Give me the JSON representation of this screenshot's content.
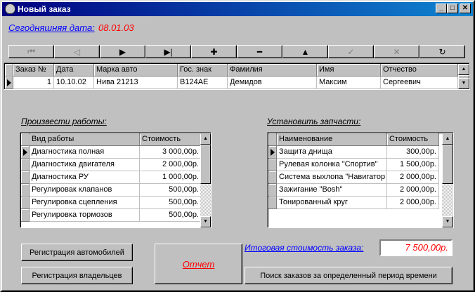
{
  "window": {
    "title": "Новый заказ"
  },
  "today": {
    "label": "Сегодняшняя дата:",
    "value": "08.01.03"
  },
  "navigator": [
    {
      "name": "first",
      "glyph": "⏮",
      "enabled": false
    },
    {
      "name": "prior",
      "glyph": "◁",
      "enabled": false
    },
    {
      "name": "next",
      "glyph": "▶",
      "enabled": true
    },
    {
      "name": "last",
      "glyph": "▶|",
      "enabled": true
    },
    {
      "name": "insert",
      "glyph": "✚",
      "enabled": true
    },
    {
      "name": "delete",
      "glyph": "━",
      "enabled": true
    },
    {
      "name": "edit",
      "glyph": "▲",
      "enabled": true
    },
    {
      "name": "post",
      "glyph": "✓",
      "enabled": false
    },
    {
      "name": "cancel",
      "glyph": "✕",
      "enabled": false
    },
    {
      "name": "refresh",
      "glyph": "↻",
      "enabled": true
    }
  ],
  "orders": {
    "columns": [
      "Заказ №",
      "Дата",
      "Марка авто",
      "Гос. знак",
      "Фамилия",
      "Имя",
      "Отчество"
    ],
    "rows": [
      [
        "1",
        "10.10.02",
        "Нива 21213",
        "В124АЕ",
        "Демидов",
        "Максим",
        "Сергеевич"
      ]
    ]
  },
  "works": {
    "label": "Произвести работы:",
    "columns": [
      "Вид работы",
      "Стоимость"
    ],
    "rows": [
      [
        "Диагностика полная",
        "3 000,00р."
      ],
      [
        "Диагностика двигателя",
        "2 000,00р."
      ],
      [
        "Диагностика РУ",
        "1 000,00р."
      ],
      [
        "Регулировак клапанов",
        "500,00р."
      ],
      [
        "Регулировка сцепления",
        "500,00р."
      ],
      [
        "Регулировка тормозов",
        "500,00р."
      ]
    ]
  },
  "parts": {
    "label": "Установить запчасти:",
    "columns": [
      "Наименование",
      "Стоимость"
    ],
    "rows": [
      [
        "Защита днища",
        "300,00р."
      ],
      [
        "Рулевая колонка \"Спортив\"",
        "1 500,00р."
      ],
      [
        "Система выхлопа \"Навигатор",
        "2 000,00р."
      ],
      [
        "Зажигание \"Bosh\"",
        "2 000,00р."
      ],
      [
        "Тонированный круг",
        "2 000,00р."
      ]
    ]
  },
  "buttons": {
    "cars": "Регистрация автомобилей",
    "owners": "Регистрация владельцев",
    "report": "Отчет",
    "search": "Поиск заказов за определенный период времени"
  },
  "total": {
    "label": "Итоговая стоимость заказа:",
    "value": "7 500,00р."
  }
}
